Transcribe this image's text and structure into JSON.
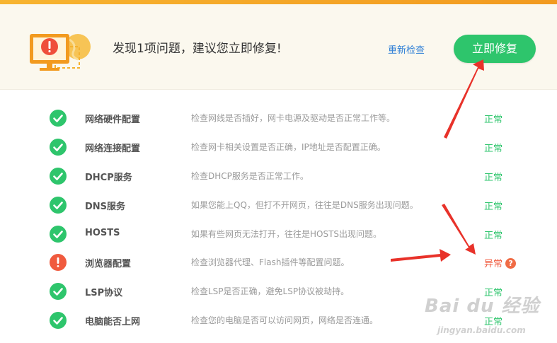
{
  "header": {
    "message": "发现1项问题，建议您立即修复!",
    "recheck_label": "重新检查",
    "fix_label": "立即修复",
    "hero_icon": "monitor-warning-icon"
  },
  "checks": [
    {
      "name": "网络硬件配置",
      "desc": "检查网线是否插好，网卡电源及驱动是否正常工作等。",
      "status": "正常",
      "state": "ok"
    },
    {
      "name": "网络连接配置",
      "desc": "检查网卡相关设置是否正确，IP地址是否配置正确。",
      "status": "正常",
      "state": "ok"
    },
    {
      "name": "DHCP服务",
      "desc": "检查DHCP服务是否正常工作。",
      "status": "正常",
      "state": "ok"
    },
    {
      "name": "DNS服务",
      "desc": "如果您能上QQ，但打不开网页，往往是DNS服务出现问题。",
      "status": "正常",
      "state": "ok"
    },
    {
      "name": "HOSTS",
      "desc": "如果有些网页无法打开，往往是HOSTS出现问题。",
      "status": "正常",
      "state": "ok"
    },
    {
      "name": "浏览器配置",
      "desc": "检查浏览器代理、Flash插件等配置问题。",
      "status": "异常",
      "state": "error"
    },
    {
      "name": "LSP协议",
      "desc": "检查LSP是否正确，避免LSP协议被劫持。",
      "status": "正常",
      "state": "ok"
    },
    {
      "name": "电脑能否上网",
      "desc": "检查您的电脑是否可以访问网页，网络是否连通。",
      "status": "正常",
      "state": "ok"
    }
  ],
  "colors": {
    "ok": "#2ec56c",
    "error": "#f05a3e",
    "accent": "#f7a823",
    "link": "#2f7fd6",
    "annotation_arrow": "#e8322a"
  },
  "watermark": {
    "main": "Bai du 经验",
    "sub": "jingyan.baidu.com"
  }
}
